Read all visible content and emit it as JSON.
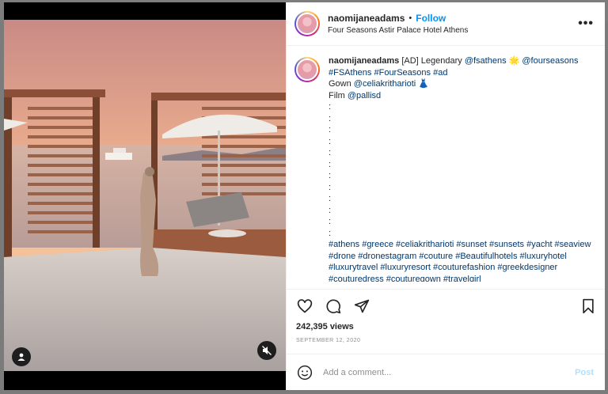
{
  "post": {
    "username": "naomijaneadams",
    "separator": "•",
    "follow_label": "Follow",
    "location": "Four Seasons Astir Palace Hotel Athens",
    "more_icon": "more-options-icon",
    "caption": {
      "username": "naomijaneadams",
      "line1_text": " [AD] Legendary ",
      "line1_tag1": "@fsathens",
      "line1_emoji": " 🌟 ",
      "line1_tag2": "@fourseasons",
      "line2_tag1": "#FSAthens",
      "line2_tag2": "#FourSeasons",
      "line2_tag3": "#ad",
      "line3_text": "Gown ",
      "line3_tag": "@celiakritharioti",
      "line3_emoji": " 👗",
      "line4_text": "Film ",
      "line4_tag": "@pallisd",
      "dots": ":\n:\n:\n:\n:\n:\n:\n:\n:\n:\n:\n:",
      "hashtags": "#athens #greece #celiakritharioti #sunset #sunsets #yacht #seaview #drone #dronestagram #couture #Beautifulhotels #luxuryhotel #luxurytravel #luxuryresort #couturefashion #greekdesigner #couturedress #couturegown #travelgirl"
    },
    "views": "242,395 views",
    "date": "SEPTEMBER 12, 2020",
    "comment_placeholder": "Add a comment...",
    "post_label": "Post"
  },
  "icons": {
    "like": "heart-icon",
    "comment": "comment-icon",
    "share": "share-icon",
    "save": "bookmark-icon",
    "emoji": "emoji-icon",
    "user_tag": "user-tag-icon",
    "mute": "muted-speaker-icon"
  },
  "colors": {
    "link_blue": "#0095f6",
    "tag_blue": "#00376b",
    "post_disabled": "#b2dffc"
  }
}
